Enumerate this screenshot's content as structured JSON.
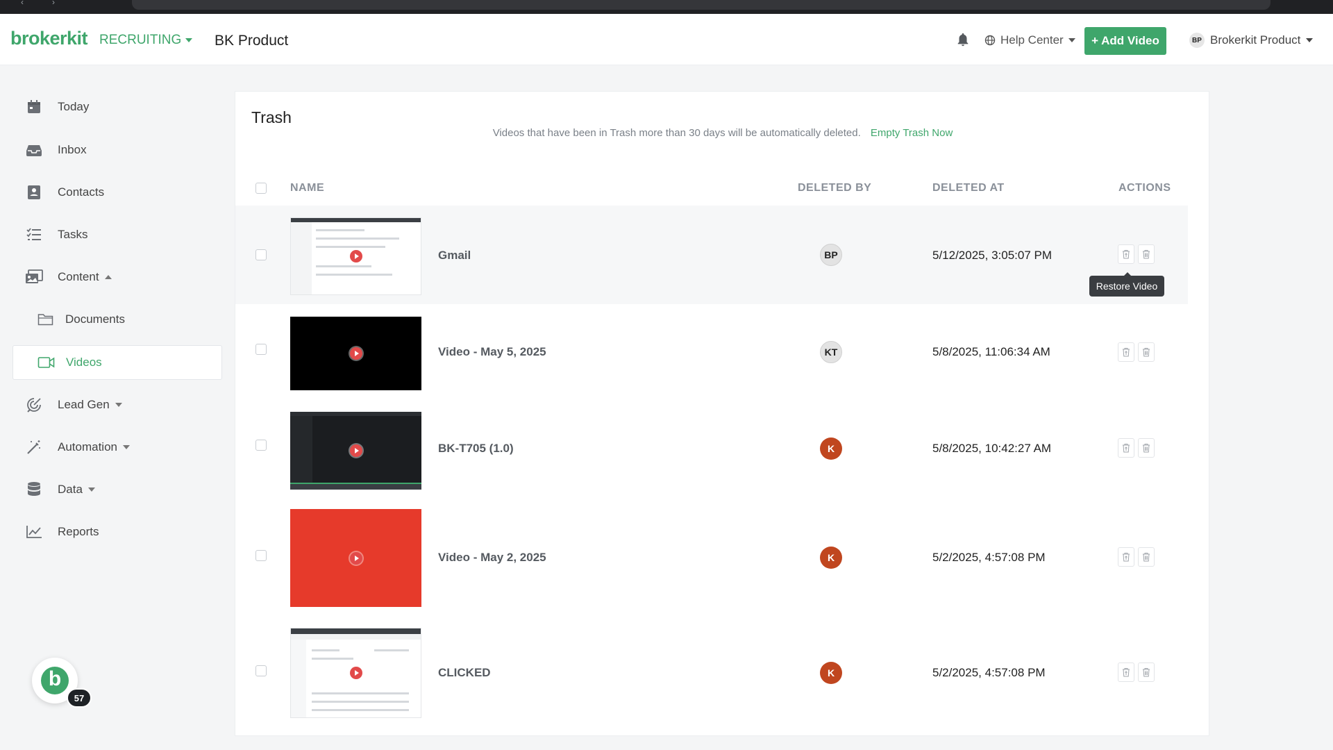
{
  "header": {
    "logo": "brokerkit",
    "module": "RECRUITING",
    "org": "BK Product",
    "help": "Help Center",
    "add_video": "Add Video",
    "user_initials": "BP",
    "user_name": "Brokerkit Product"
  },
  "sidebar": {
    "items": [
      {
        "label": "Today",
        "icon": "calendar-icon"
      },
      {
        "label": "Inbox",
        "icon": "inbox-icon"
      },
      {
        "label": "Contacts",
        "icon": "contacts-icon"
      },
      {
        "label": "Tasks",
        "icon": "tasks-icon"
      },
      {
        "label": "Content",
        "icon": "content-icon"
      },
      {
        "label": "Documents",
        "icon": "folder-icon"
      },
      {
        "label": "Videos",
        "icon": "video-icon"
      },
      {
        "label": "Lead Gen",
        "icon": "lead-gen-icon"
      },
      {
        "label": "Automation",
        "icon": "magic-wand-icon"
      },
      {
        "label": "Data",
        "icon": "database-icon"
      },
      {
        "label": "Reports",
        "icon": "chart-icon"
      }
    ],
    "active": "Videos",
    "badge_count": "57"
  },
  "trash": {
    "title": "Trash",
    "notice": "Videos that have been in Trash more than 30 days will be automatically deleted.",
    "empty_link": "Empty Trash Now",
    "columns": {
      "name": "NAME",
      "deleted_by": "DELETED BY",
      "deleted_at": "DELETED AT",
      "actions": "ACTIONS"
    },
    "rows": [
      {
        "name": "Gmail",
        "deleted_by": "BP",
        "deleted_at": "5/12/2025, 3:05:07 PM"
      },
      {
        "name": "Video - May 5, 2025",
        "deleted_by": "KT",
        "deleted_at": "5/8/2025, 11:06:34 AM"
      },
      {
        "name": "BK-T705 (1.0)",
        "deleted_by": "K",
        "deleted_at": "5/8/2025, 10:42:27 AM"
      },
      {
        "name": "Video - May 2, 2025",
        "deleted_by": "K",
        "deleted_at": "5/2/2025, 4:57:08 PM"
      },
      {
        "name": "CLICKED",
        "deleted_by": "K",
        "deleted_at": "5/2/2025, 4:57:08 PM"
      }
    ],
    "tooltip": "Restore Video"
  },
  "colors": {
    "brand": "#3fa66b",
    "avatar_k": "#c0461f",
    "thumb_red": "#e63a2b"
  }
}
